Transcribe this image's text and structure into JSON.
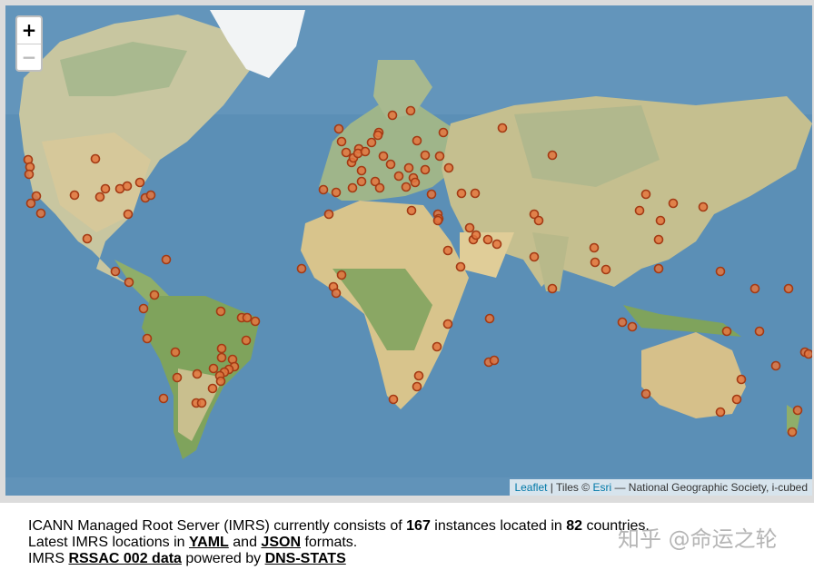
{
  "map": {
    "zoom_in": "+",
    "zoom_out": "−",
    "attribution": {
      "leaflet": "Leaflet",
      "sep1": " | Tiles © ",
      "esri": "Esri",
      "rest": " — National Geographic Society, i-cubed"
    },
    "marker_color": "#e4753e",
    "ocean_color": "#5a8fb5"
  },
  "info": {
    "line1_pre": "ICANN Managed Root Server (IMRS) currently consists of ",
    "instances": "167",
    "line1_mid": " instances located in ",
    "countries": "82",
    "line1_post": " countries.",
    "line2_pre": "Latest IMRS locations in ",
    "yaml": "YAML",
    "line2_mid": " and ",
    "json": "JSON",
    "line2_post": " formats.",
    "line3_pre": "IMRS ",
    "rssac": "RSSAC 002 data",
    "line3_mid": " powered by ",
    "dnsstats": "DNS-STATS"
  },
  "watermark": "知乎 @命运之轮"
}
